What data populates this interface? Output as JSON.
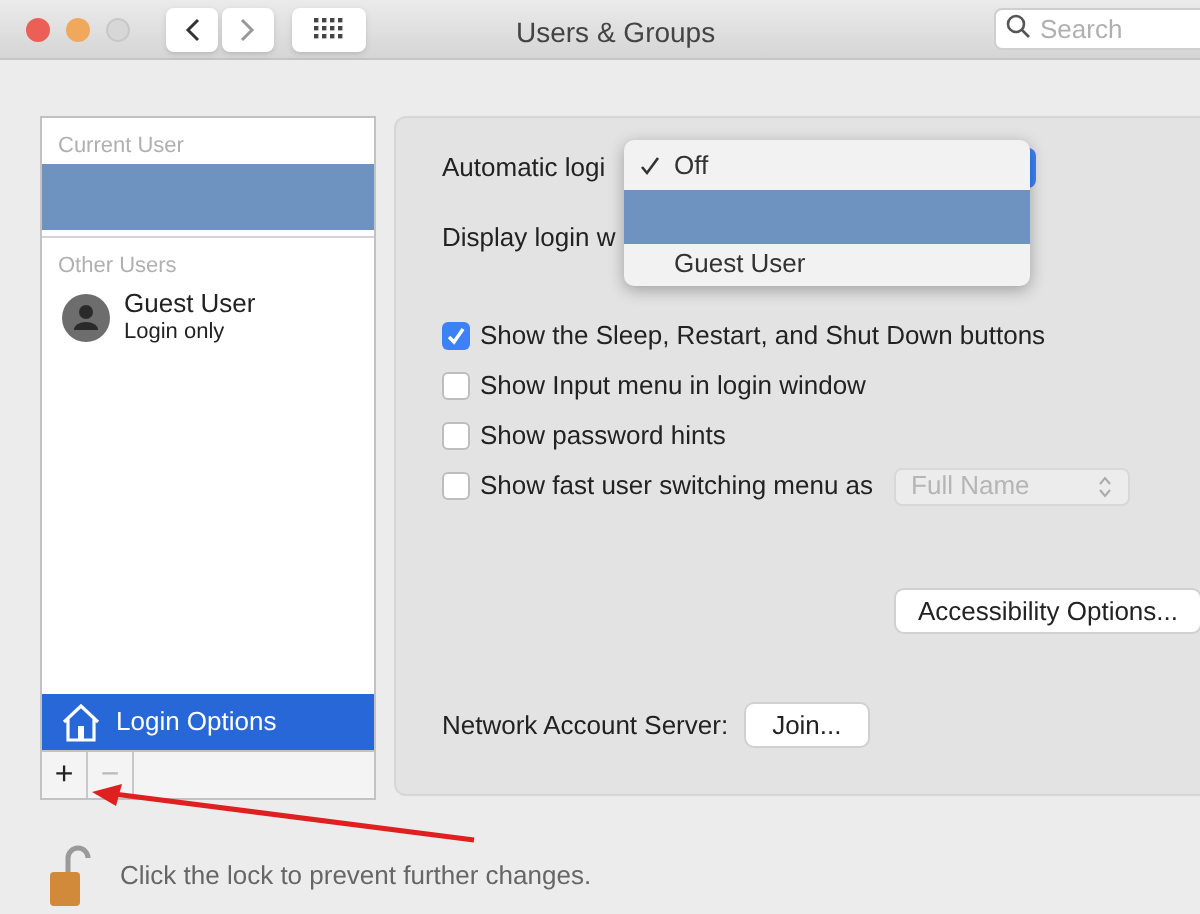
{
  "window": {
    "title": "Users & Groups",
    "search": {
      "placeholder": "Search"
    }
  },
  "sidebar": {
    "sections": [
      {
        "heading": "Current User",
        "users": [
          {
            "selected": true
          }
        ]
      },
      {
        "heading": "Other Users",
        "users": [
          {
            "name": "Guest User",
            "subtitle": "Login only",
            "selected": false
          }
        ]
      }
    ],
    "login_options": {
      "label": "Login Options",
      "selected": true
    },
    "buttons": [
      "+",
      "−"
    ]
  },
  "options": {
    "automatic_login_label": "Automatic logi",
    "display_login_label": "Display login w",
    "checkboxes": [
      {
        "label": "Show the Sleep, Restart, and Shut Down buttons",
        "checked": true
      },
      {
        "label": "Show Input menu in login window",
        "checked": false
      },
      {
        "label": "Show password hints",
        "checked": false
      },
      {
        "label": "Show fast user switching menu as",
        "checked": false,
        "popup": {
          "value": "Full Name",
          "disabled": true
        }
      }
    ],
    "accessibility_button": "Accessibility Options...",
    "network_label": "Network Account Server:",
    "join_button": "Join..."
  },
  "dropdown_menu": {
    "items": [
      {
        "label": "Off",
        "checked": true,
        "selected": false
      },
      {
        "checked": false,
        "selected": true
      },
      {
        "label": "Guest User",
        "checked": false,
        "selected": false
      }
    ]
  },
  "lock_text": "Click the lock to prevent further changes."
}
